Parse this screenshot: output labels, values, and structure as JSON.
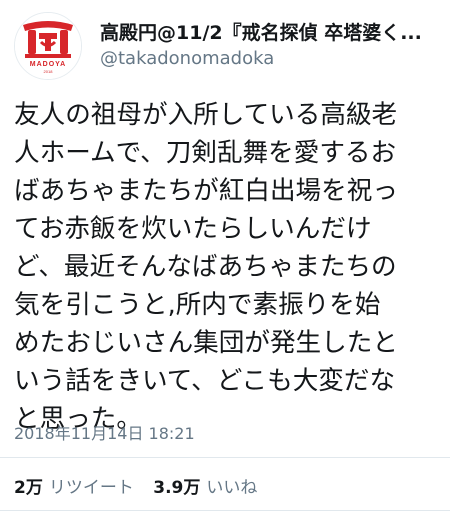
{
  "tweet": {
    "author": {
      "display_name": "高殿円@11/2『戒名探偵 卒塔婆く...",
      "handle": "@takadonomadoka",
      "avatar_icon": "madoya-logo-icon",
      "avatar_logo_text": "MADOYA",
      "avatar_logo_subtext": "2018",
      "brand_color": "#d7262a"
    },
    "text": "友人の祖母が入所している高級老\n人ホームで、刀剣乱舞を愛するお\nばあちゃまたちが紅白出場を祝っ\nてお赤飯を炊いたらしいんだけ\nど、最近そんなばあちゃまたちの\n気を引こうと,所内で素振りを始\nめたおじいさん集団が発生したと\nいう話をきいて、どこも大変だな\nと思った。",
    "timestamp": "2018年11月14日 18:21",
    "stats": {
      "retweets": {
        "count": "2万",
        "label": "リツイート"
      },
      "likes": {
        "count": "3.9万",
        "label": "いいね"
      }
    }
  }
}
